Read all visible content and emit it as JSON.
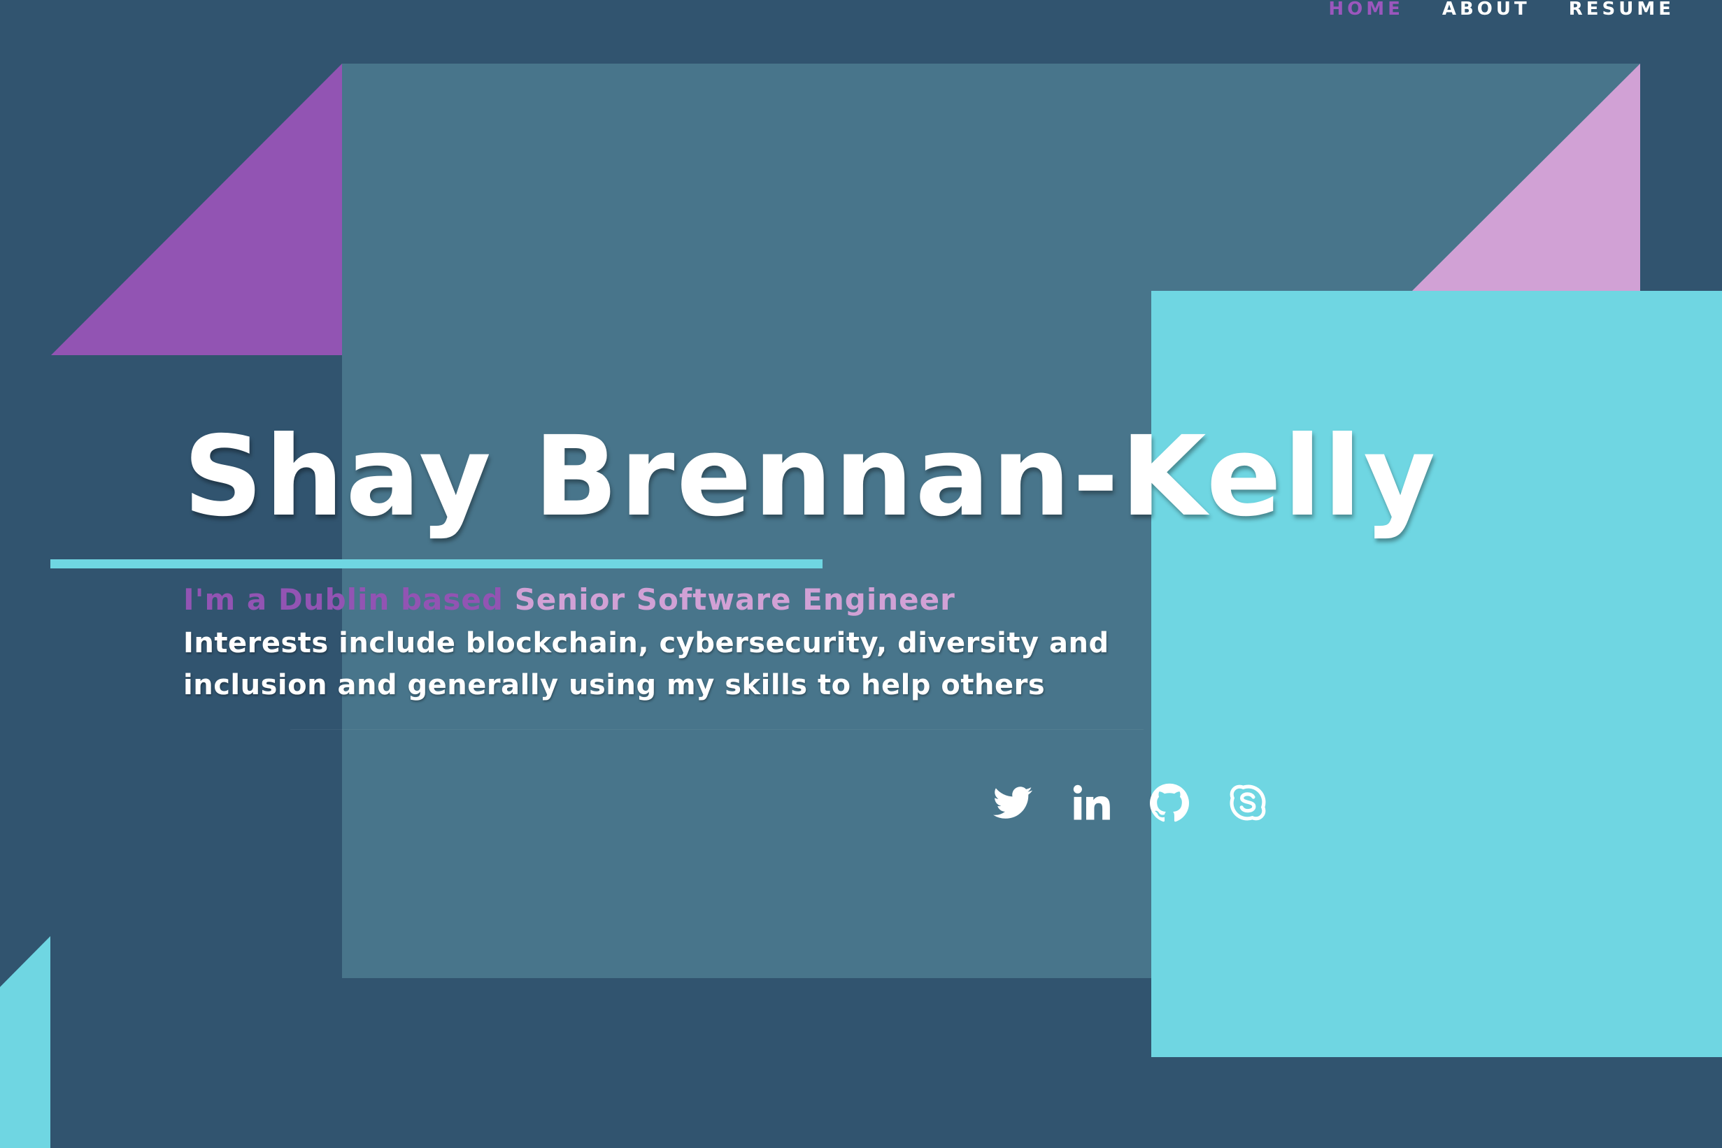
{
  "nav": {
    "items": [
      {
        "label": "HOME",
        "active": true
      },
      {
        "label": "ABOUT",
        "active": false
      },
      {
        "label": "RESUME",
        "active": false
      }
    ]
  },
  "hero": {
    "name": "Shay Brennan-Kelly",
    "tagline_prefix": "I'm a Dublin based",
    "tagline_role": "Senior Software Engineer",
    "bio": "Interests include blockchain, cybersecurity, diversity and inclusion and generally using my skills to help others"
  },
  "social": [
    {
      "icon": "twitter-icon"
    },
    {
      "icon": "linkedin-icon"
    },
    {
      "icon": "github-icon"
    },
    {
      "icon": "skype-icon"
    }
  ],
  "colors": {
    "background": "#31546f",
    "panel": "#48758b",
    "purple": "#9254b3",
    "pink": "#d1a1d5",
    "cyan": "#6fd6e2",
    "text": "#ffffff"
  }
}
